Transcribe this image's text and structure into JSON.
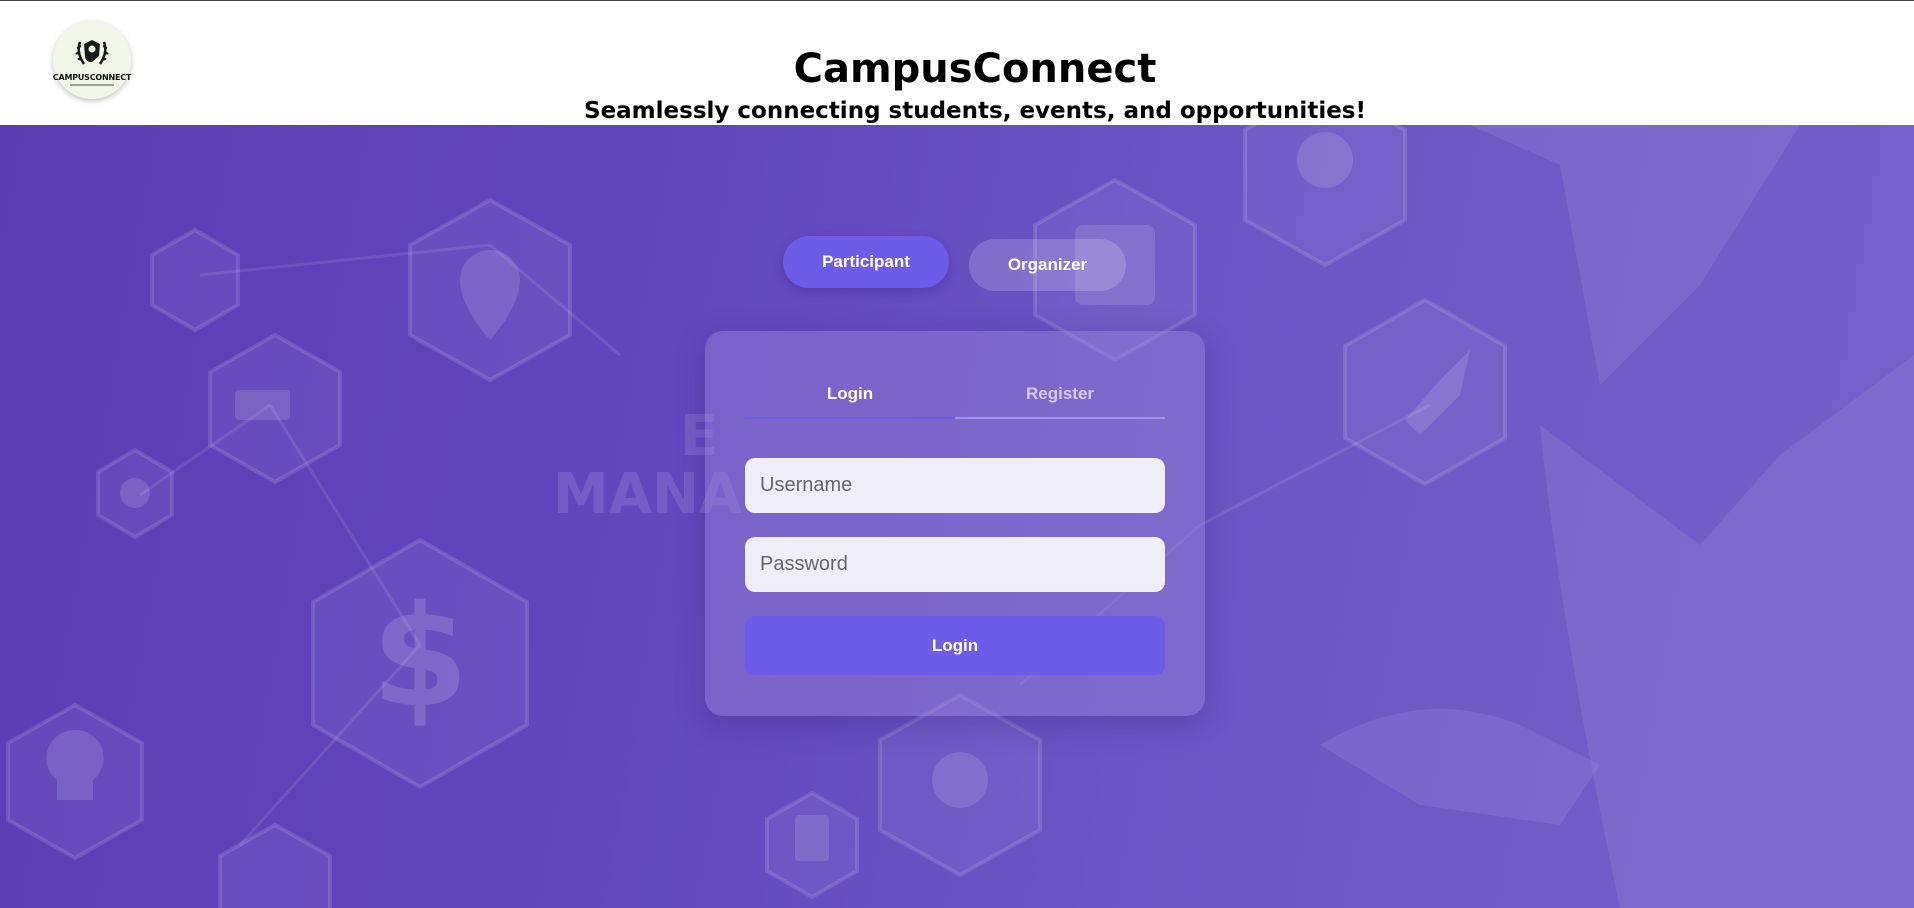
{
  "header": {
    "logo_icon": "laurel-shield-icon",
    "logo_text": "CAMPUSCONNECT",
    "title": "CampusConnect",
    "tagline": "Seamlessly connecting students, events, and opportunities!"
  },
  "hero": {
    "background_icons": [
      "gear-icon",
      "location-pin-icon",
      "calendar-icon",
      "target-icon",
      "truck-icon",
      "globe-icon",
      "dollar-icon",
      "lightbulb-icon",
      "lock-icon",
      "clipboard-icon",
      "rocket-icon",
      "people-icon"
    ],
    "background_text": "E MANA"
  },
  "role_toggle": {
    "participant_label": "Participant",
    "organizer_label": "Organizer",
    "selected": "Participant"
  },
  "auth_card": {
    "tabs": {
      "login_label": "Login",
      "register_label": "Register",
      "selected": "Login"
    },
    "username_placeholder": "Username",
    "password_placeholder": "Password",
    "submit_label": "Login"
  },
  "colors": {
    "accent": "#6c5ce7",
    "hero_background": "#6148be",
    "input_background": "#efedf6"
  }
}
